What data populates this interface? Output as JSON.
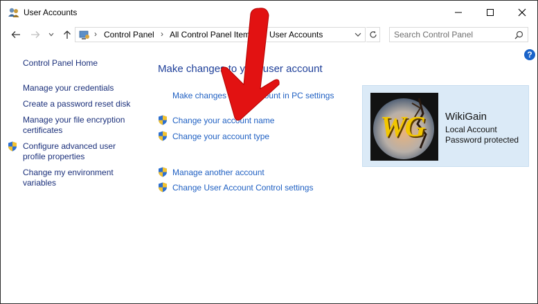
{
  "window": {
    "title": "User Accounts",
    "controls": [
      "minimize",
      "maximize",
      "close"
    ]
  },
  "address_bar": {
    "breadcrumbs": [
      "Control Panel",
      "All Control Panel Items",
      "User Accounts"
    ]
  },
  "search": {
    "placeholder": "Search Control Panel"
  },
  "help": {
    "label": "?"
  },
  "sidebar": {
    "home": "Control Panel Home",
    "items": [
      {
        "label": "Manage your credentials",
        "shield": false
      },
      {
        "label": "Create a password reset disk",
        "shield": false
      },
      {
        "label": "Manage your file encryption certificates",
        "shield": false
      },
      {
        "label": "Configure advanced user profile properties",
        "shield": true
      },
      {
        "label": "Change my environment variables",
        "shield": false
      }
    ]
  },
  "main": {
    "heading": "Make changes to your user account",
    "pc_settings_link": "Make changes to my account in PC settings",
    "links": [
      {
        "label": "Change your account name",
        "shield": true
      },
      {
        "label": "Change your account type",
        "shield": true
      },
      {
        "label": "Manage another account",
        "shield": true
      },
      {
        "label": "Change User Account Control settings",
        "shield": true
      }
    ]
  },
  "account": {
    "name": "WikiGain",
    "type": "Local Account",
    "status": "Password protected",
    "avatar_text": "WG"
  },
  "colors": {
    "link": "#1e5fc2",
    "heading": "#1e3f99",
    "card_bg": "#dbeaf7",
    "arrow": "#e21212"
  }
}
